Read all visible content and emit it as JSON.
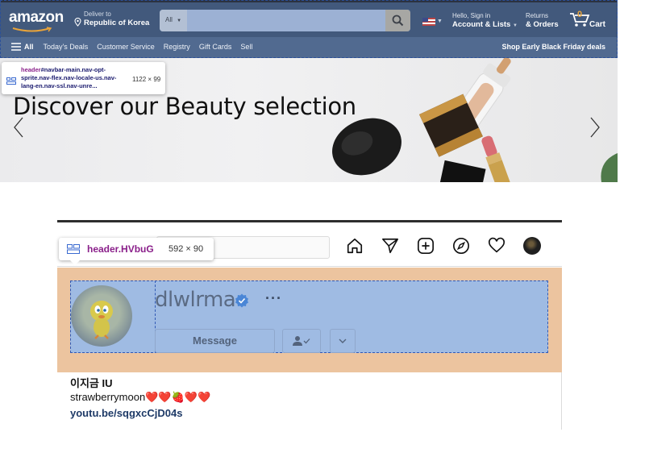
{
  "amazon": {
    "logo": "amazon",
    "deliver_label": "Deliver to",
    "deliver_location": "Republic of Korea",
    "search_category": "All",
    "account_greeting": "Hello, Sign in",
    "account_label": "Account & Lists",
    "returns_label": "Returns",
    "orders_label": "& Orders",
    "cart_count": "0",
    "cart_label": "Cart",
    "all_menu": "All",
    "nav_items": [
      "Today's Deals",
      "Customer Service",
      "Registry",
      "Gift Cards",
      "Sell"
    ],
    "promo": "Shop Early Black Friday deals",
    "hero_title": "Discover our Beauty selection",
    "tooltip": {
      "tag": "header",
      "selector": "#navbar-main.nav-opt-sprite.nav-flex.nav-locale-us.nav-lang-en.nav-ssl.nav-unre...",
      "size": "1122 × 99"
    }
  },
  "instagram": {
    "username": "dlwlrma",
    "message_button": "Message",
    "more": "···",
    "full_name": "이지금 IU",
    "bio": "strawberrymoon❤️❤️🍓❤️❤️",
    "link": "youtu.be/sqgxcCjD04s",
    "tooltip": {
      "selector": "header.HVbuG",
      "size": "592 × 90"
    }
  }
}
